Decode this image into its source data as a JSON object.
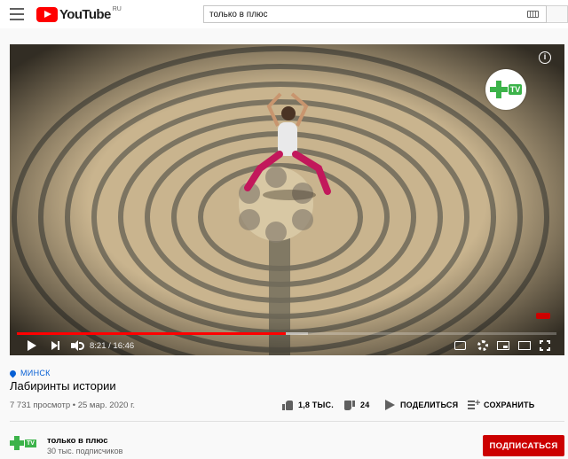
{
  "masthead": {
    "logo_text": "YouTube",
    "region": "RU",
    "search_value": "только в плюс"
  },
  "player": {
    "current_time": "8:21",
    "duration": "16:46",
    "time_display": "8:21 / 16:46",
    "progress_fraction": 0.498,
    "buffered_fraction": 0.54,
    "badge_tv": "TV",
    "info": "i"
  },
  "video": {
    "location": "МИНСК",
    "title": "Лабиринты истории",
    "views_date": "7 731 просмотр • 25 мар. 2020 г."
  },
  "actions": {
    "likes": "1,8 ТЫС.",
    "dislikes": "24",
    "share": "ПОДЕЛИТЬСЯ",
    "save": "СОХРАНИТЬ"
  },
  "channel": {
    "logo_tv": "TV",
    "name": "только в плюс",
    "subscribers": "30 тыс. подписчиков",
    "subscribe_label": "ПОДПИСАТЬСЯ"
  },
  "colors": {
    "brand_red": "#ff0000",
    "subscribe_red": "#cc0000",
    "channel_green": "#3cb34a",
    "link_blue": "#065fd4"
  }
}
